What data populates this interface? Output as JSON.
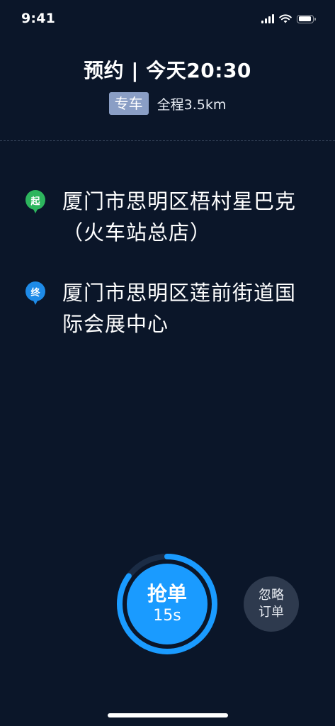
{
  "status_bar": {
    "time": "9:41",
    "icons": [
      "cellular-signal-icon",
      "wifi-icon",
      "battery-icon"
    ]
  },
  "header": {
    "title": "预约 | 今天20:30",
    "service_badge": "专车",
    "distance": "全程3.5km"
  },
  "route": {
    "start": {
      "marker": "起",
      "address": "厦门市思明区梧村星巴克（火车站总店）"
    },
    "end": {
      "marker": "终",
      "address": "厦门市思明区莲前街道国际会展中心"
    }
  },
  "actions": {
    "grab": {
      "label": "抢单",
      "countdown": "15s",
      "countdown_progress": 0.85
    },
    "ignore": {
      "line1": "忽略",
      "line2": "订单"
    }
  },
  "colors": {
    "background": "#0b1629",
    "badge": "#8a9ec5",
    "start_marker": "#2db55d",
    "end_marker": "#1e8be8",
    "grab_button": "#1a9bff",
    "ignore_button": "#2e3a4e"
  }
}
